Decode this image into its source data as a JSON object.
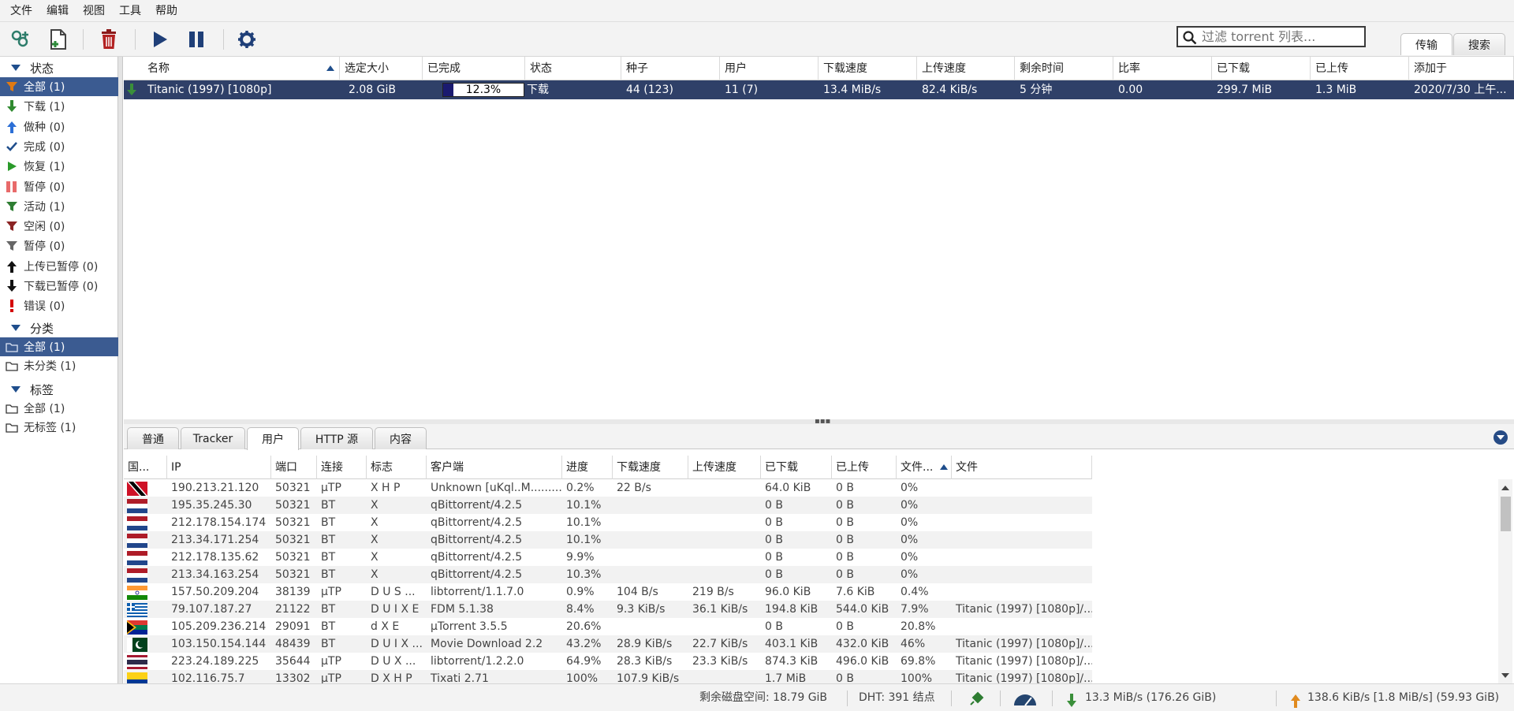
{
  "menubar": [
    "文件",
    "编辑",
    "视图",
    "工具",
    "帮助"
  ],
  "toolbar": {
    "filter_placeholder": "过滤 torrent 列表...",
    "tabs": [
      "传输",
      "搜索"
    ]
  },
  "sidebar": {
    "status_header": "状态",
    "status_items": [
      {
        "label": "全部 (1)",
        "icon": "filter-all-icon",
        "color": "#e07a14"
      },
      {
        "label": "下载 (1)",
        "icon": "download-arrow-icon",
        "color": "#2f8a2f"
      },
      {
        "label": "做种 (0)",
        "icon": "upload-arrow-icon",
        "color": "#2c6fd6"
      },
      {
        "label": "完成 (0)",
        "icon": "checkmark-icon",
        "color": "#1f4e8c"
      },
      {
        "label": "恢复 (1)",
        "icon": "play-icon",
        "color": "#2a9a2a"
      },
      {
        "label": "暂停 (0)",
        "icon": "pause-icon",
        "color": "#e86a6a"
      },
      {
        "label": "活动 (1)",
        "icon": "filter-active-icon",
        "color": "#2e7d32"
      },
      {
        "label": "空闲 (0)",
        "icon": "filter-inactive-icon",
        "color": "#8b2323"
      },
      {
        "label": "暂停 (0)",
        "icon": "filter-stalled-icon",
        "color": "#666666"
      },
      {
        "label": "上传已暂停 (0)",
        "icon": "upload-stalled-icon",
        "color": "#111111"
      },
      {
        "label": "下载已暂停 (0)",
        "icon": "download-stalled-icon",
        "color": "#111111"
      },
      {
        "label": "错误 (0)",
        "icon": "error-icon",
        "color": "#d40000"
      }
    ],
    "category_header": "分类",
    "category_items": [
      "全部 (1)",
      "未分类 (1)"
    ],
    "tag_header": "标签",
    "tag_items": [
      "全部 (1)",
      "无标签 (1)"
    ]
  },
  "torrent_table": {
    "columns": [
      "名称",
      "选定大小",
      "已完成",
      "状态",
      "种子",
      "用户",
      "下载速度",
      "上传速度",
      "剩余时间",
      "比率",
      "已下载",
      "已上传",
      "添加于"
    ],
    "rows": [
      {
        "name": "Titanic (1997) [1080p]",
        "size": "2.08 GiB",
        "progress_text": "12.3%",
        "progress": 0.123,
        "status": "下载",
        "seeds": "44 (123)",
        "peers": "11 (7)",
        "dl_speed": "13.4 MiB/s",
        "ul_speed": "82.4 KiB/s",
        "eta": "5 分钟",
        "ratio": "0.00",
        "downloaded": "299.7 MiB",
        "uploaded": "1.3 MiB",
        "added": "2020/7/30 上午..."
      }
    ]
  },
  "bottom_tabs": [
    "普通",
    "Tracker",
    "用户",
    "HTTP 源",
    "内容"
  ],
  "peers_table": {
    "columns": [
      "国...",
      "IP",
      "端口",
      "连接",
      "标志",
      "客户端",
      "进度",
      "下载速度",
      "上传速度",
      "已下载",
      "已上传",
      "文件...",
      "文件"
    ],
    "rows": [
      {
        "flag": "tt",
        "ip": "190.213.21.120",
        "port": "50321",
        "conn": "μTP",
        "flags": "X H P",
        "client": "Unknown [uKql..M.........",
        "progress": "0.2%",
        "dl": "22 B/s",
        "ul": "",
        "downloaded": "64.0 KiB",
        "uploaded": "0 B",
        "relevance": "0%",
        "files": ""
      },
      {
        "flag": "nl",
        "ip": "195.35.245.30",
        "port": "50321",
        "conn": "BT",
        "flags": "X",
        "client": "qBittorrent/4.2.5",
        "progress": "10.1%",
        "dl": "",
        "ul": "",
        "downloaded": "0 B",
        "uploaded": "0 B",
        "relevance": "0%",
        "files": ""
      },
      {
        "flag": "nl",
        "ip": "212.178.154.174",
        "port": "50321",
        "conn": "BT",
        "flags": "X",
        "client": "qBittorrent/4.2.5",
        "progress": "10.1%",
        "dl": "",
        "ul": "",
        "downloaded": "0 B",
        "uploaded": "0 B",
        "relevance": "0%",
        "files": ""
      },
      {
        "flag": "nl",
        "ip": "213.34.171.254",
        "port": "50321",
        "conn": "BT",
        "flags": "X",
        "client": "qBittorrent/4.2.5",
        "progress": "10.1%",
        "dl": "",
        "ul": "",
        "downloaded": "0 B",
        "uploaded": "0 B",
        "relevance": "0%",
        "files": ""
      },
      {
        "flag": "nl",
        "ip": "212.178.135.62",
        "port": "50321",
        "conn": "BT",
        "flags": "X",
        "client": "qBittorrent/4.2.5",
        "progress": "9.9%",
        "dl": "",
        "ul": "",
        "downloaded": "0 B",
        "uploaded": "0 B",
        "relevance": "0%",
        "files": ""
      },
      {
        "flag": "nl",
        "ip": "213.34.163.254",
        "port": "50321",
        "conn": "BT",
        "flags": "X",
        "client": "qBittorrent/4.2.5",
        "progress": "10.3%",
        "dl": "",
        "ul": "",
        "downloaded": "0 B",
        "uploaded": "0 B",
        "relevance": "0%",
        "files": ""
      },
      {
        "flag": "in",
        "ip": "157.50.209.204",
        "port": "38139",
        "conn": "μTP",
        "flags": "D U S ...",
        "client": "libtorrent/1.1.7.0",
        "progress": "0.9%",
        "dl": "104 B/s",
        "ul": "219 B/s",
        "downloaded": "96.0 KiB",
        "uploaded": "7.6 KiB",
        "relevance": "0.4%",
        "files": ""
      },
      {
        "flag": "gr",
        "ip": "79.107.187.27",
        "port": "21122",
        "conn": "BT",
        "flags": "D U I X E",
        "client": "FDM 5.1.38",
        "progress": "8.4%",
        "dl": "9.3 KiB/s",
        "ul": "36.1 KiB/s",
        "downloaded": "194.8 KiB",
        "uploaded": "544.0 KiB",
        "relevance": "7.9%",
        "files": "Titanic (1997) [1080p]/..."
      },
      {
        "flag": "za",
        "ip": "105.209.236.214",
        "port": "29091",
        "conn": "BT",
        "flags": "d X E",
        "client": "μTorrent 3.5.5",
        "progress": "20.6%",
        "dl": "",
        "ul": "",
        "downloaded": "0 B",
        "uploaded": "0 B",
        "relevance": "20.8%",
        "files": ""
      },
      {
        "flag": "pk",
        "ip": "103.150.154.144",
        "port": "48439",
        "conn": "BT",
        "flags": "D U I X ...",
        "client": "Movie Download 2.2",
        "progress": "43.2%",
        "dl": "28.9 KiB/s",
        "ul": "22.7 KiB/s",
        "downloaded": "403.1 KiB",
        "uploaded": "432.0 KiB",
        "relevance": "46%",
        "files": "Titanic (1997) [1080p]/..."
      },
      {
        "flag": "th",
        "ip": "223.24.189.225",
        "port": "35644",
        "conn": "μTP",
        "flags": "D U X ...",
        "client": "libtorrent/1.2.2.0",
        "progress": "64.9%",
        "dl": "28.3 KiB/s",
        "ul": "23.3 KiB/s",
        "downloaded": "874.3 KiB",
        "uploaded": "496.0 KiB",
        "relevance": "69.8%",
        "files": "Titanic (1997) [1080p]/..."
      },
      {
        "flag": "co",
        "ip": "102.116.75.7",
        "port": "13302",
        "conn": "μTP",
        "flags": "D X H P",
        "client": "Tixati 2.71",
        "progress": "100%",
        "dl": "107.9 KiB/s",
        "ul": "",
        "downloaded": "1.7 MiB",
        "uploaded": "0 B",
        "relevance": "100%",
        "files": "Titanic (1997) [1080p]/..."
      }
    ]
  },
  "statusbar": {
    "free_space": "剩余磁盘空间: 18.79 GiB",
    "dht": "DHT: 391 结点",
    "download": "13.3 MiB/s (176.26 GiB)",
    "upload": "138.6 KiB/s [1.8 MiB/s] (59.93 GiB)"
  },
  "colors": {
    "selection": "#3b5b91",
    "row_selected": "#2f4068",
    "accent": "#1f4e8c"
  }
}
